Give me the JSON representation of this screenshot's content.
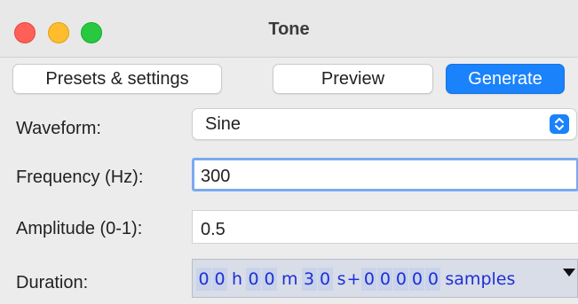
{
  "window": {
    "title": "Tone"
  },
  "toolbar": {
    "presets_label": "Presets & settings",
    "preview_label": "Preview",
    "generate_label": "Generate"
  },
  "form": {
    "waveform": {
      "label": "Waveform:",
      "value": "Sine"
    },
    "frequency": {
      "label": "Frequency (Hz):",
      "value": "300"
    },
    "amplitude": {
      "label": "Amplitude (0-1):",
      "value": "0.5"
    },
    "duration": {
      "label": "Duration:",
      "hours": [
        "0",
        "0"
      ],
      "hours_unit": "h",
      "minutes": [
        "0",
        "0"
      ],
      "minutes_unit": "m",
      "seconds": [
        "3",
        "0"
      ],
      "seconds_unit": "s",
      "plus": "+",
      "samples": [
        "0",
        "0",
        "0",
        "0",
        "0"
      ],
      "samples_unit": "samples"
    }
  },
  "colors": {
    "accent": "#1a82fb",
    "focus_ring": "#7aaaf0",
    "time_text": "#1e2fd6",
    "close": "#fe5f57",
    "minimize": "#febc2e",
    "maximize": "#28c840"
  },
  "icons": {
    "close": "close-dot-icon",
    "minimize": "minimize-dot-icon",
    "maximize": "maximize-dot-icon",
    "select_arrow": "chevron-updown-icon",
    "duration_menu": "triangle-down-icon"
  }
}
